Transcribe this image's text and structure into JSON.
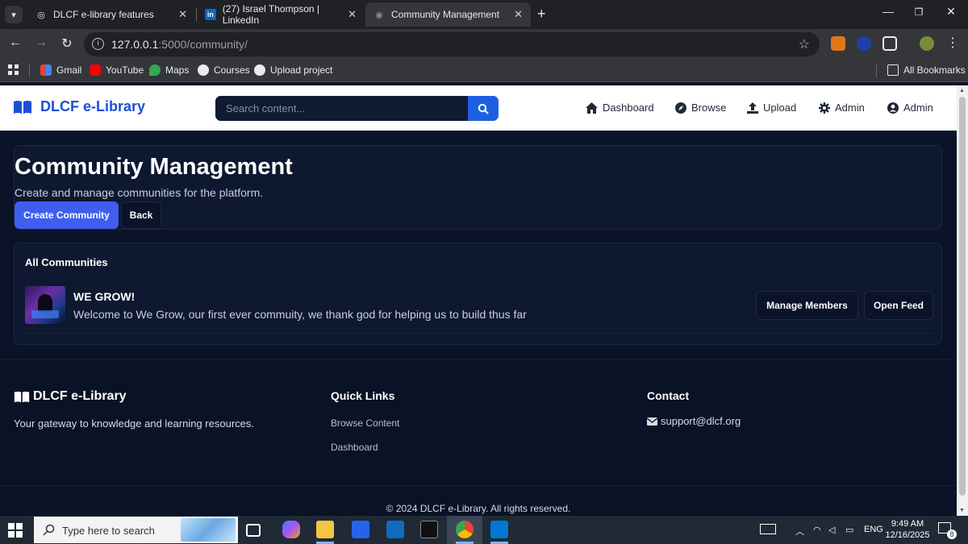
{
  "browser": {
    "tabs": [
      {
        "title": "DLCF e-library features",
        "active": false
      },
      {
        "title": "(27) Israel Thompson | LinkedIn",
        "active": false
      },
      {
        "title": "Community Management",
        "active": true
      }
    ],
    "url_host": "127.0.0.1",
    "url_path": ":5000/community/",
    "bookmarks": [
      "Gmail",
      "YouTube",
      "Maps",
      "Courses",
      "Upload project"
    ],
    "all_bookmarks": "All Bookmarks"
  },
  "header": {
    "brand": "DLCF e-Library",
    "search_placeholder": "Search content...",
    "nav": [
      "Dashboard",
      "Browse",
      "Upload",
      "Admin",
      "Admin"
    ]
  },
  "hero": {
    "title": "Community Management",
    "subtitle": "Create and manage communities for the platform.",
    "create_label": "Create Community",
    "back_label": "Back"
  },
  "communities": {
    "heading": "All Communities",
    "items": [
      {
        "name": "WE GROW!",
        "description": "Welcome to We Grow, our first ever commuity, we thank god for helping us to build thus far",
        "manage_label": "Manage Members",
        "feed_label": "Open Feed"
      }
    ]
  },
  "footer": {
    "brand": "DLCF e-Library",
    "tagline": "Your gateway to knowledge and learning resources.",
    "quick_links_heading": "Quick Links",
    "quick_links": [
      "Browse Content",
      "Dashboard"
    ],
    "contact_heading": "Contact",
    "email": "support@dlcf.org",
    "copyright": "© 2024 DLCF e-Library. All rights reserved."
  },
  "taskbar": {
    "search_placeholder": "Type here to search",
    "language": "ENG",
    "time": "9:49 AM",
    "date": "12/16/2025",
    "notification_count": "8"
  },
  "colors": {
    "accent": "#3f5ef0",
    "brand_blue": "#1d4ed8",
    "page_bg": "#0b1328"
  }
}
